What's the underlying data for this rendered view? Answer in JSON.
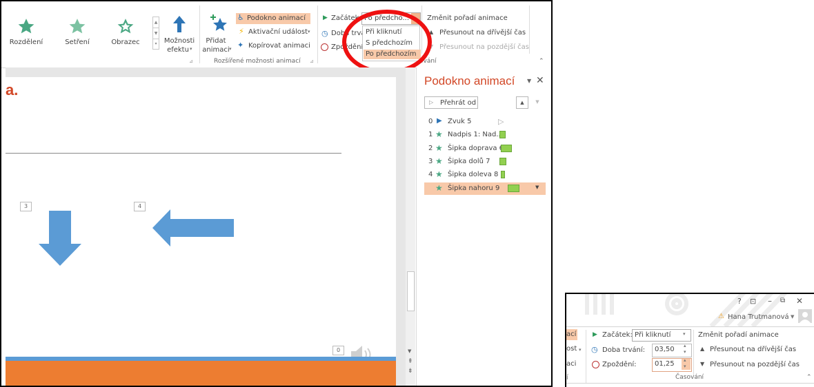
{
  "ribbon": {
    "gallery": [
      "Rozdělení",
      "Setření",
      "Obrazec"
    ],
    "effect_options": {
      "line1": "Možnosti",
      "line2": "efektu"
    },
    "add_animation": {
      "line1": "Přidat",
      "line2": "animaci"
    },
    "pane_btn": "Podokno animací",
    "trigger_btn": "Aktivační událost",
    "painter_btn": "Kopírovat animaci",
    "group_advanced": "Rozšířené možnosti animací",
    "start_label": "Začátek:",
    "start_value": "Po předcho...",
    "duration_label": "Doba trvá",
    "delay_label": "Zpoždění",
    "reorder_title": "Změnit pořadí animace",
    "move_earlier": "Přesunout na dřívější čas",
    "move_later": "Přesunout na pozdější čas",
    "group_timing_tail": "ování",
    "dropdown_options": [
      "Při kliknutí",
      "S předchozím",
      "Po předchozím"
    ]
  },
  "slide": {
    "title_fragment": "a.",
    "tag3": "3",
    "tag4": "4",
    "tag0": "0"
  },
  "pane": {
    "title": "Podokno animací",
    "play_btn": "Přehrát od",
    "items": [
      {
        "num": "0",
        "label": "Zvuk 5"
      },
      {
        "num": "1",
        "label": "Nadpis 1: Nad..."
      },
      {
        "num": "2",
        "label": "Šipka doprava 6"
      },
      {
        "num": "3",
        "label": "Šipka dolů 7"
      },
      {
        "num": "4",
        "label": "Šipka doleva 8"
      },
      {
        "num": "",
        "label": "Šipka nahoru 9"
      }
    ]
  },
  "inset": {
    "help": "?",
    "user": "Hana Trutmanová",
    "frag_top": "ací",
    "frag_mid": "ost",
    "frag_low": "aci",
    "frag_bot": "í",
    "start_label": "Začátek:",
    "start_value": "Při kliknutí",
    "duration_label": "Doba trvání:",
    "duration_value": "03,50",
    "delay_label": "Zpoždění:",
    "delay_value": "01,25",
    "reorder_title": "Změnit pořadí animace",
    "move_earlier": "Přesunout na dřívější čas",
    "move_later": "Přesunout na pozdější čas",
    "group_label": "Časování"
  },
  "colors": {
    "accent": "#d24726",
    "arrow": "#5b9bd5",
    "orange": "#ed7d31",
    "selected": "#f8c9a9"
  }
}
